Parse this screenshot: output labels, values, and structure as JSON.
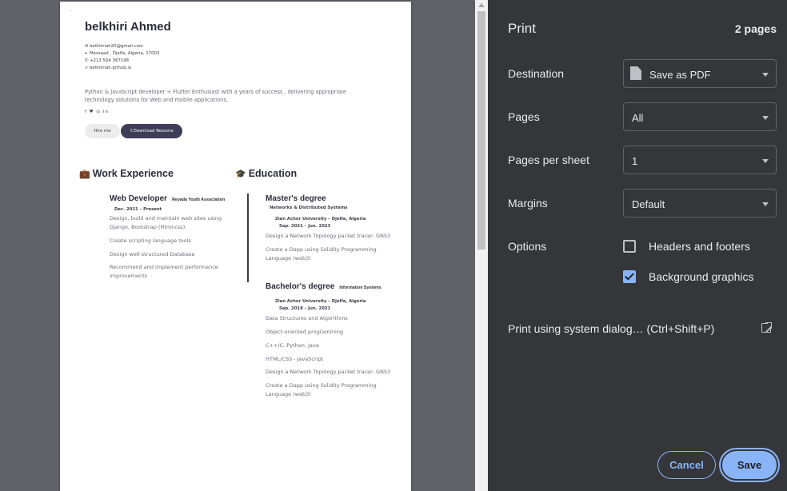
{
  "preview": {
    "page_marker": "'",
    "name": "belkhiri Ahmed",
    "contacts": [
      {
        "icon": "mail-icon",
        "glyph": "✉",
        "text": "belkhiriah20@gmail.com"
      },
      {
        "icon": "location-icon",
        "glyph": "⌖",
        "text": "Messaad , Djelfa, Algeria, 17003"
      },
      {
        "icon": "whatsapp-icon",
        "glyph": "✆",
        "text": "+213 554 367198"
      },
      {
        "icon": "send-icon",
        "glyph": "➶",
        "text": "belkhiriah.github.io"
      }
    ],
    "bio": "Python & JavaScript developer + Flutter Enthusiast with a years of success , delivering appropriate technology solutions for Web and mobile applications.",
    "social": "f ♥ ◎ in",
    "hire_label": "Hire me",
    "download_label": "⇩Download Resume",
    "work": {
      "icon_glyph": "💼",
      "heading": "Work Experience",
      "job_title": "Web Developer",
      "job_org": "Reyada Youth Association",
      "job_date": "Dec. 2021 – Present",
      "items": [
        "Design, build and maintain web sites using Django, Bootstrap (Html-css).",
        "Create scripting language tools",
        "Design well-structured Database",
        "Recommend and implement performance improvements"
      ]
    },
    "education": {
      "icon_glyph": "🎓",
      "heading": "Education",
      "master": {
        "title": "Master's degree",
        "field": "Networks & Distributed Systems",
        "school": "Zian Achor University – Djelfa, Algeria",
        "dates": "Sep. 2021 – Jun. 2023",
        "items": [
          "Design a Network Topology packet tracer, GNS3",
          "Create a Dapp using Solidity Programming Language (web3)"
        ]
      },
      "bachelor": {
        "title": "Bachelor's degree",
        "field": "Information Systems",
        "school": "Zian Achor University – Djelfa, Algeria",
        "dates": "Sep. 2018 – Jun. 2021",
        "items": [
          "Data Structures and Algorithms",
          "Object-oriented programming",
          "C++/C, Python, Java",
          "HTML/CSS - JavaScript",
          "Design a Network Topology packet tracer, GNS3",
          "Create a Dapp using Solidity Programming Language (web3)"
        ]
      }
    }
  },
  "panel": {
    "title": "Print",
    "page_count": "2 pages",
    "destination": {
      "label": "Destination",
      "value": "Save as PDF"
    },
    "pages": {
      "label": "Pages",
      "value": "All"
    },
    "pages_per_sheet": {
      "label": "Pages per sheet",
      "value": "1"
    },
    "margins": {
      "label": "Margins",
      "value": "Default"
    },
    "options": {
      "label": "Options",
      "headers_footers": {
        "label": "Headers and footers",
        "checked": false
      },
      "background_graphics": {
        "label": "Background graphics",
        "checked": true
      }
    },
    "system_dialog": "Print using system dialog… (Ctrl+Shift+P)",
    "cancel_label": "Cancel",
    "save_label": "Save"
  },
  "colors": {
    "panel_bg": "#35363a",
    "accent": "#8ab4f8",
    "preview_bg": "#5f6368",
    "resume_button": "#3e3e58"
  }
}
